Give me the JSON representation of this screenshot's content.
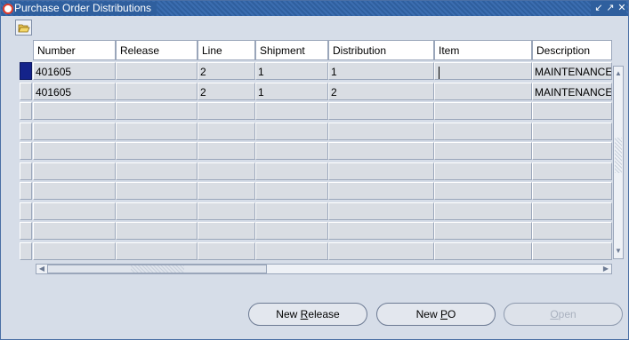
{
  "window": {
    "title": "Purchase Order Distributions",
    "controls": [
      "minimize",
      "maximize",
      "close"
    ]
  },
  "toolbar": {
    "open_folder_icon": "folder-open-icon"
  },
  "table": {
    "columns": [
      "Number",
      "Release",
      "Line",
      "Shipment",
      "Distribution",
      "Item",
      "Description"
    ],
    "rows": [
      {
        "number": "401605",
        "release": "",
        "line": "2",
        "shipment": "1",
        "distribution": "1",
        "item": "",
        "description": "MAINTENANCE"
      },
      {
        "number": "401605",
        "release": "",
        "line": "2",
        "shipment": "1",
        "distribution": "2",
        "item": "",
        "description": "MAINTENANCE"
      }
    ],
    "empty_row_count": 8,
    "selected_row": 1
  },
  "buttons": {
    "new_release": {
      "pre": "New ",
      "mnemonic": "R",
      "post": "elease"
    },
    "new_po": {
      "pre": "New ",
      "mnemonic": "P",
      "post": "O"
    },
    "open": {
      "pre": "",
      "mnemonic": "O",
      "post": "pen",
      "enabled": false
    }
  },
  "colors": {
    "titlebar": "#2f5f9e",
    "selected_row_indicator": "#14238a",
    "background": "#d6dde8"
  }
}
